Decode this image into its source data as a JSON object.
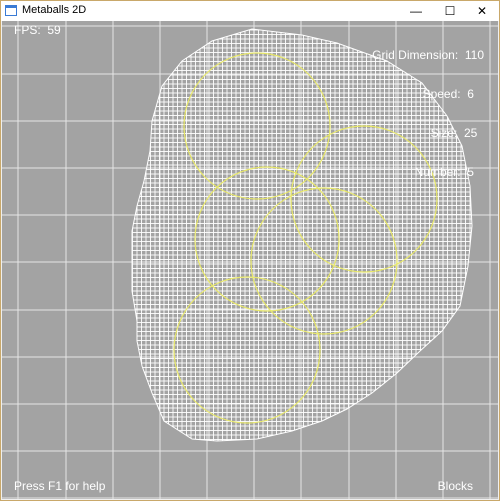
{
  "window": {
    "title": "Metaballs 2D",
    "controls": {
      "minimize": "—",
      "maximize": "☐",
      "close": "✕"
    },
    "icon": "app-window-icon"
  },
  "hud": {
    "fps_label": "FPS:",
    "fps_value": "59",
    "stats": [
      {
        "label": "Grid Dimension:",
        "value": "110"
      },
      {
        "label": "Speed:",
        "value": "6"
      },
      {
        "label": "Size:",
        "value": "25"
      },
      {
        "label": "Number:",
        "value": "5"
      }
    ],
    "help": "Press F1 for help",
    "mode": "Blocks"
  },
  "colors": {
    "background": "#a3a3a3",
    "grid_lines": "#ffffff",
    "circles": "#e8e86a"
  }
}
